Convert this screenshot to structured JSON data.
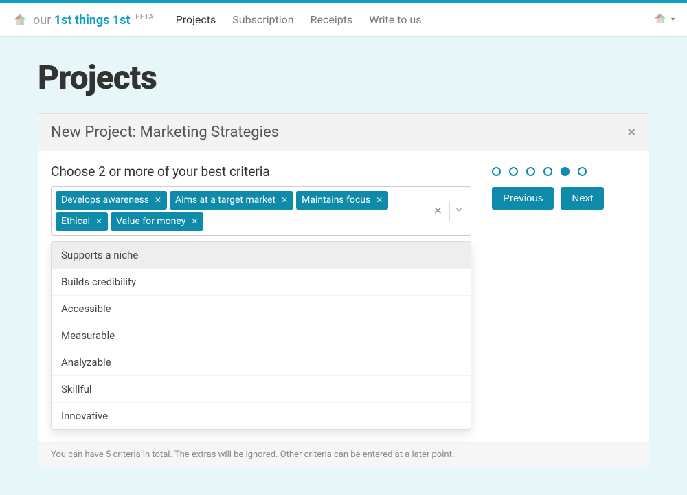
{
  "brand": {
    "prefix": "our",
    "main": "1st things 1st",
    "badge": "BETA"
  },
  "nav": {
    "items": [
      {
        "label": "Projects",
        "active": true
      },
      {
        "label": "Subscription",
        "active": false
      },
      {
        "label": "Receipts",
        "active": false
      },
      {
        "label": "Write to us",
        "active": false
      }
    ]
  },
  "page": {
    "title": "Projects"
  },
  "panel": {
    "title": "New Project: Marketing Strategies",
    "criteria_label": "Choose 2 or more of your best criteria",
    "selected_tags": [
      "Develops awareness",
      "Aims at a target market",
      "Maintains focus",
      "Ethical",
      "Value for money"
    ],
    "dropdown_options": [
      "Supports a niche",
      "Builds credibility",
      "Accessible",
      "Measurable",
      "Analyzable",
      "Skillful",
      "Innovative"
    ],
    "footer_note": "You can have 5 criteria in total. The extras will be ignored. Other criteria can be entered at a later point."
  },
  "stepper": {
    "total": 6,
    "active_index": 4
  },
  "buttons": {
    "previous": "Previous",
    "next": "Next"
  }
}
